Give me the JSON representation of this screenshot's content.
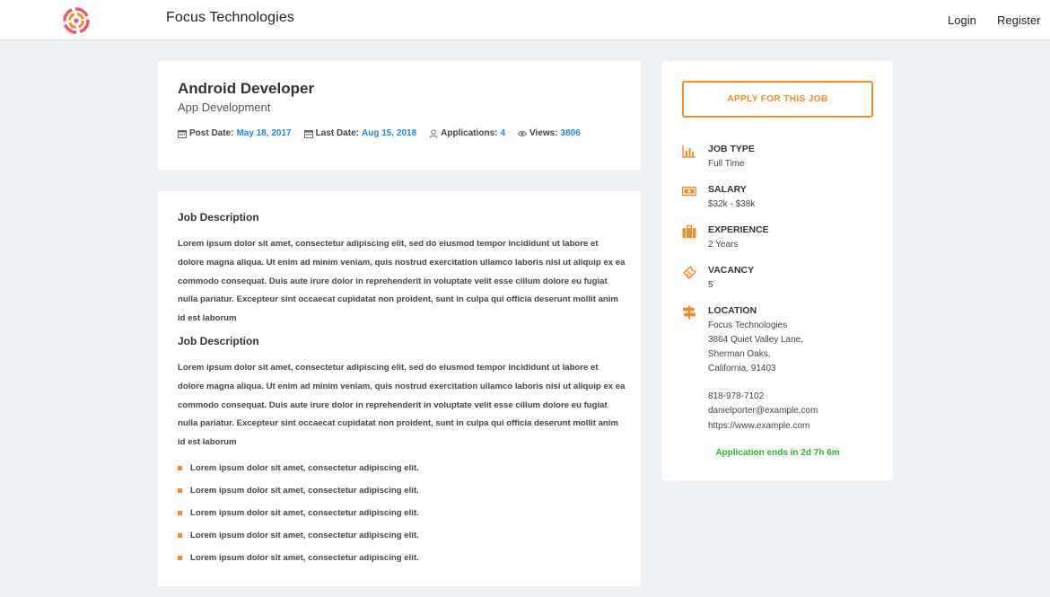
{
  "header": {
    "brand": "Focus Technologies",
    "login_label": "Login",
    "register_label": "Register"
  },
  "job": {
    "title": "Android Developer",
    "category": "App Development",
    "meta": {
      "post_date_label": "Post Date:",
      "post_date": "May 18, 2017",
      "last_date_label": "Last Date:",
      "last_date": "Aug 15, 2018",
      "applications_label": "Applications:",
      "applications": "4",
      "views_label": "Views:",
      "views": "3806"
    }
  },
  "description": {
    "section1_title": "Job Description",
    "section1_text": "Lorem ipsum dolor sit amet, consectetur adipiscing elit, sed do eiusmod tempor incididunt ut labore et dolore magna aliqua. Ut enim ad minim veniam, quis nostrud exercitation ullamco laboris nisi ut aliquip ex ea commodo consequat. Duis aute irure dolor in reprehenderit in voluptate velit esse cillum dolore eu fugiat nulla pariatur. Excepteur sint occaecat cupidatat non proident, sunt in culpa qui officia deserunt mollit anim id est laborum",
    "section2_title": "Job Description",
    "section2_text": "Lorem ipsum dolor sit amet, consectetur adipiscing elit, sed do eiusmod tempor incididunt ut labore et dolore magna aliqua. Ut enim ad minim veniam, quis nostrud exercitation ullamco laboris nisi ut aliquip ex ea commodo consequat. Duis aute irure dolor in reprehenderit in voluptate velit esse cillum dolore eu fugiat nulla pariatur. Excepteur sint occaecat cupidatat non proident, sunt in culpa qui officia deserunt mollit anim id est laborum",
    "bullets": [
      "Lorem ipsum dolor sit amet, consectetur adipiscing elit.",
      "Lorem ipsum dolor sit amet, consectetur adipiscing elit.",
      "Lorem ipsum dolor sit amet, consectetur adipiscing elit.",
      "Lorem ipsum dolor sit amet, consectetur adipiscing elit.",
      "Lorem ipsum dolor sit amet, consectetur adipiscing elit."
    ]
  },
  "sidebar": {
    "apply_label": "APPLY FOR THIS JOB",
    "job_type_label": "JOB TYPE",
    "job_type": "Full Time",
    "salary_label": "SALARY",
    "salary": "$32k - $38k",
    "experience_label": "EXPERIENCE",
    "experience": "2 Years",
    "vacancy_label": "VACANCY",
    "vacancy": "5",
    "location_label": "LOCATION",
    "location_lines": [
      "Focus Technologies",
      "3864 Quiet Valley Lane,",
      "Sherman Oaks,",
      "California, 91403"
    ],
    "phone": "818-978-7102",
    "email": "danielporter@example.com",
    "website": "https://www.example.com",
    "ends_text": "Application ends in 2d 7h 6m"
  },
  "colors": {
    "accent": "#f68b1f",
    "link": "#1c8adb",
    "success": "#2fb52f",
    "background": "#eff2f5"
  },
  "icons": {
    "logo": "target-logo",
    "job_type": "bar-chart-icon",
    "salary": "money-icon",
    "experience": "briefcase-icon",
    "vacancy": "ticket-icon",
    "location": "signpost-icon",
    "post_date": "calendar-icon",
    "last_date": "calendar-icon",
    "applications": "user-icon",
    "views": "eye-icon"
  }
}
